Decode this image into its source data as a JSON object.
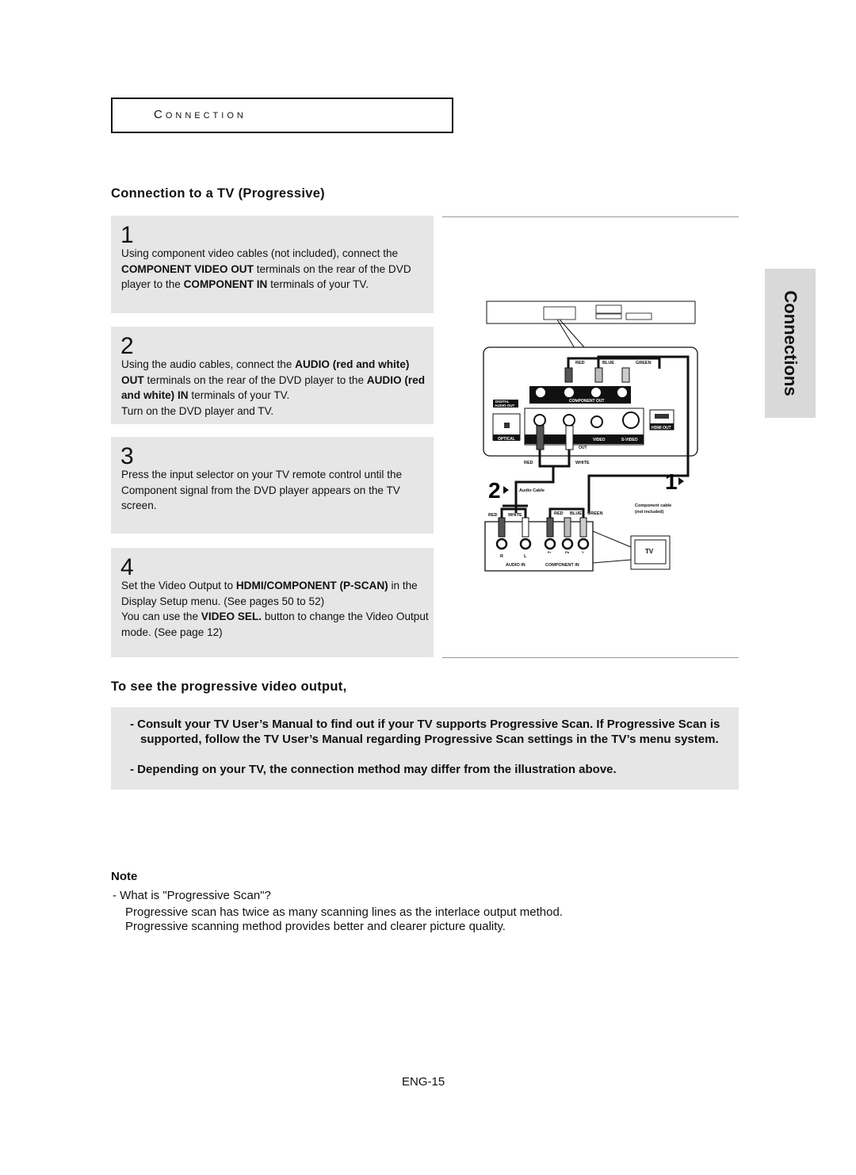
{
  "section": {
    "title": "Connection"
  },
  "heading": "Connection to a TV (Progressive)",
  "side_tab": "Connections",
  "steps": [
    {
      "number": "1",
      "parts": [
        {
          "t": "Using component video cables (not included), connect the ",
          "b": false
        },
        {
          "t": "COMPONENT VIDEO OUT",
          "b": true
        },
        {
          "t": " terminals on the rear of the DVD player to the ",
          "b": false
        },
        {
          "t": "COMPONENT IN",
          "b": true
        },
        {
          "t": " terminals of your TV.",
          "b": false
        }
      ]
    },
    {
      "number": "2",
      "parts": [
        {
          "t": "Using the audio cables, connect the ",
          "b": false
        },
        {
          "t": "AUDIO (red and white) OUT",
          "b": true
        },
        {
          "t": " terminals on the rear of the DVD player to the ",
          "b": false
        },
        {
          "t": "AUDIO (red and white) IN",
          "b": true
        },
        {
          "t": " terminals of your TV.",
          "b": false
        },
        {
          "t": "\nTurn on the DVD player and TV.",
          "b": false
        }
      ]
    },
    {
      "number": "3",
      "parts": [
        {
          "t": "Press the input selector on your TV remote control until the Component signal from the DVD player appears on the TV screen.",
          "b": false
        }
      ]
    },
    {
      "number": "4",
      "parts": [
        {
          "t": "Set the Video Output to ",
          "b": false
        },
        {
          "t": "HDMI/COMPONENT (P-SCAN)",
          "b": true
        },
        {
          "t": " in the Display Setup menu. (See pages 50 to 52)",
          "b": false
        },
        {
          "t": "\nYou can use the ",
          "b": false
        },
        {
          "t": "VIDEO SEL.",
          "b": true
        },
        {
          "t": " button to change the Video Output mode. (See page 12)",
          "b": false
        }
      ]
    }
  ],
  "diagram": {
    "dvd_labels": {
      "red": "RED",
      "blue": "BLUE",
      "green": "GREEN",
      "digital_audio_out_1": "DIGITAL",
      "digital_audio_out_2": "AUDIO OUT",
      "coaxial": "COAXIAL",
      "component_out": "COMPONENT OUT",
      "optical": "OPTICAL",
      "audio": "AUDIO",
      "video": "VIDEO",
      "s_video": "S-VIDEO",
      "out": "OUT",
      "hdmi_out": "HDMI OUT",
      "pr": "Pr",
      "pb": "Pb",
      "y": "Y"
    },
    "cable_labels": {
      "red": "RED",
      "white": "WHITE",
      "audio_cable": "Audio Cable",
      "component_cable_1": "Component cable",
      "component_cable_2": "(not included)",
      "step2": "2",
      "step1": "1"
    },
    "tv_labels": {
      "red": "RED",
      "white": "WHITE",
      "comp_red": "RED",
      "comp_blue": "BLUE",
      "comp_green": "GREEN",
      "r": "R",
      "l": "L",
      "pr": "Pr",
      "pb": "Pb",
      "y": "Y",
      "audio_in": "AUDIO IN",
      "component_in": "COMPONENT IN",
      "tv": "TV"
    },
    "colors": {
      "red_plug": "#555555",
      "blue_plug": "#bbbbbb",
      "green_plug": "#cccccc",
      "white_plug": "#ffffff"
    }
  },
  "progressive": {
    "heading": "To see the progressive video output,",
    "tips": [
      "- Consult your TV User’s Manual to find out if your TV supports Progressive Scan. If Progressive Scan is supported, follow the TV User’s Manual regarding Progressive Scan settings in the TV’s menu system.",
      "- Depending on your TV, the connection method may differ from the illustration above."
    ]
  },
  "note": {
    "title": "Note",
    "lines": [
      "-  What is \"Progressive Scan\"?",
      "Progressive scan has twice as many scanning lines as the interlace output method.",
      "Progressive scanning method provides better and clearer picture quality."
    ]
  },
  "page_number": "ENG-15"
}
